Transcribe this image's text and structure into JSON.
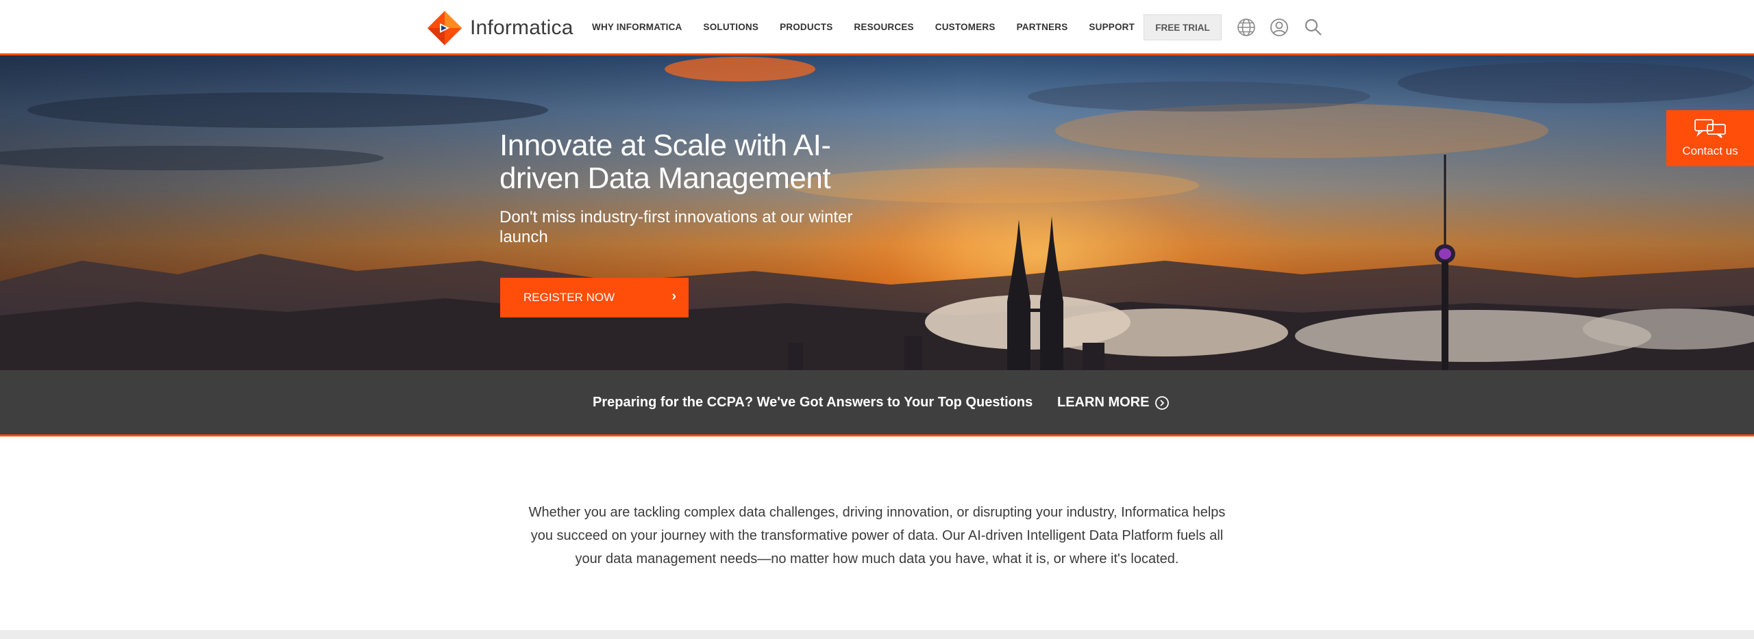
{
  "header": {
    "logo_text": "Informatica",
    "nav": [
      {
        "label": "WHY INFORMATICA"
      },
      {
        "label": "SOLUTIONS"
      },
      {
        "label": "PRODUCTS"
      },
      {
        "label": "RESOURCES"
      },
      {
        "label": "CUSTOMERS"
      },
      {
        "label": "PARTNERS"
      },
      {
        "label": "SUPPORT"
      }
    ],
    "free_trial": "FREE TRIAL",
    "icons": [
      "globe-icon",
      "user-icon",
      "search-icon"
    ]
  },
  "hero": {
    "title": "Innovate at Scale with AI-driven Data Management",
    "subtitle": "Don't miss industry-first innovations at our winter launch",
    "cta": "REGISTER NOW",
    "cta_icon": "chevron-right-icon"
  },
  "contact": {
    "label": "Contact us",
    "icon": "chat-bubbles-icon"
  },
  "banner": {
    "text": "Preparing for the CCPA? We've Got Answers to Your Top Questions",
    "link": "LEARN MORE",
    "link_icon": "circle-arrow-icon"
  },
  "intro": {
    "text": "Whether you are tackling complex data challenges, driving innovation, or disrupting your industry, Informatica helps you succeed on your journey with the transformative power of data. Our AI-driven Intelligent Data Platform fuels all your data management needs—no matter how much data you have, what it is, or where it's located."
  },
  "colors": {
    "accent": "#ff4d0a",
    "banner_bg": "#3f3f3f",
    "header_bg": "#ffffff"
  }
}
